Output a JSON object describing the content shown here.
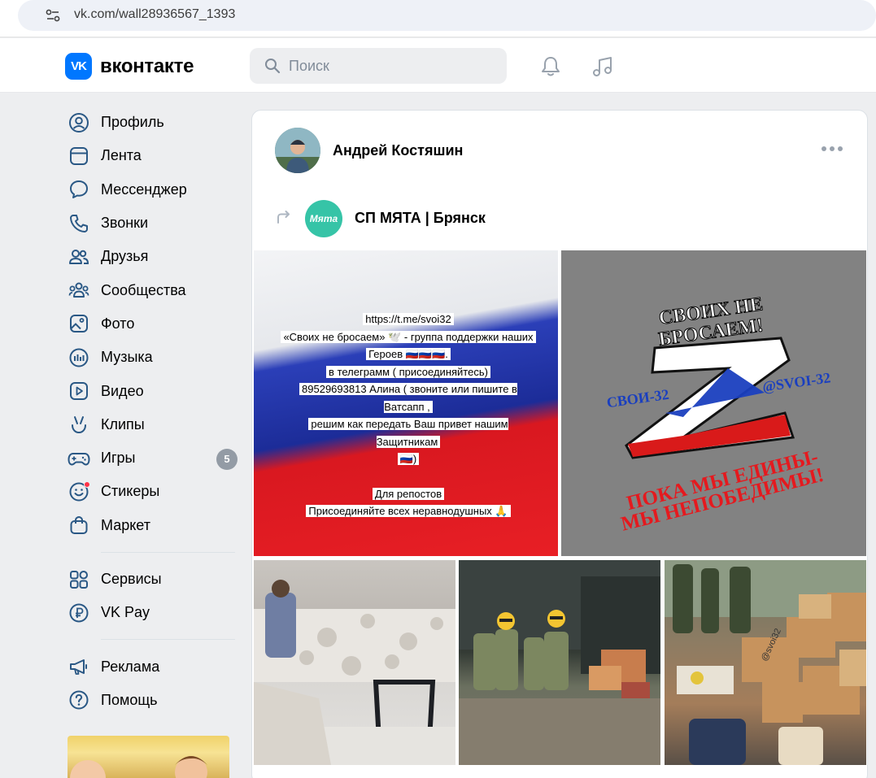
{
  "browser": {
    "url": "vk.com/wall28936567_1393"
  },
  "header": {
    "logo_mark": "VK",
    "logo_text": "вконтакте",
    "search_placeholder": "Поиск",
    "icons": [
      "bell-icon",
      "music-icon"
    ]
  },
  "sidebar": {
    "items": [
      {
        "label": "Профиль",
        "icon": "profile-icon"
      },
      {
        "label": "Лента",
        "icon": "feed-icon"
      },
      {
        "label": "Мессенджер",
        "icon": "messenger-icon"
      },
      {
        "label": "Звонки",
        "icon": "phone-icon"
      },
      {
        "label": "Друзья",
        "icon": "friends-icon"
      },
      {
        "label": "Сообщества",
        "icon": "communities-icon"
      },
      {
        "label": "Фото",
        "icon": "photo-icon"
      },
      {
        "label": "Музыка",
        "icon": "music-icon"
      },
      {
        "label": "Видео",
        "icon": "video-icon"
      },
      {
        "label": "Клипы",
        "icon": "clips-icon"
      },
      {
        "label": "Игры",
        "icon": "games-icon",
        "badge": "5"
      },
      {
        "label": "Стикеры",
        "icon": "stickers-icon"
      },
      {
        "label": "Маркет",
        "icon": "market-icon"
      }
    ],
    "items2": [
      {
        "label": "Сервисы",
        "icon": "services-icon"
      },
      {
        "label": "VK Pay",
        "icon": "vkpay-icon"
      }
    ],
    "items3": [
      {
        "label": "Реклама",
        "icon": "megaphone-icon"
      },
      {
        "label": "Помощь",
        "icon": "help-icon"
      }
    ]
  },
  "post": {
    "author": "Андрей Костяшин",
    "repost_source": "СП МЯТА | Брянск",
    "repost_avatar_text": "Мята",
    "image1_lines": [
      "https://t.me/svoi32",
      "«Своих не бросаем» 🕊️ -  группа поддержки наших",
      "Героев 🇷🇺🇷🇺🇷🇺.",
      "в телеграмм ( присоединяйтесь)",
      "89529693813 Алина ( звоните или пишите в Ватсапп ,",
      "решим как передать Ваш привет нашим Защитникам",
      "🇷🇺)",
      "",
      "Для репостов",
      "Присоединяйте всех неравнодушных 🙏"
    ],
    "image2": {
      "top_text_1": "СВОИХ НЕ",
      "top_text_2": "БРОСАЕМ!",
      "left_tag": "СВОИ-32",
      "right_tag": "@SVOI-32",
      "bottom_text_1": "ПОКА МЫ ЕДИНЫ-",
      "bottom_text_2": "МЫ НЕПОБЕДИМЫ!"
    },
    "image5_watermark": "@svoi32"
  }
}
